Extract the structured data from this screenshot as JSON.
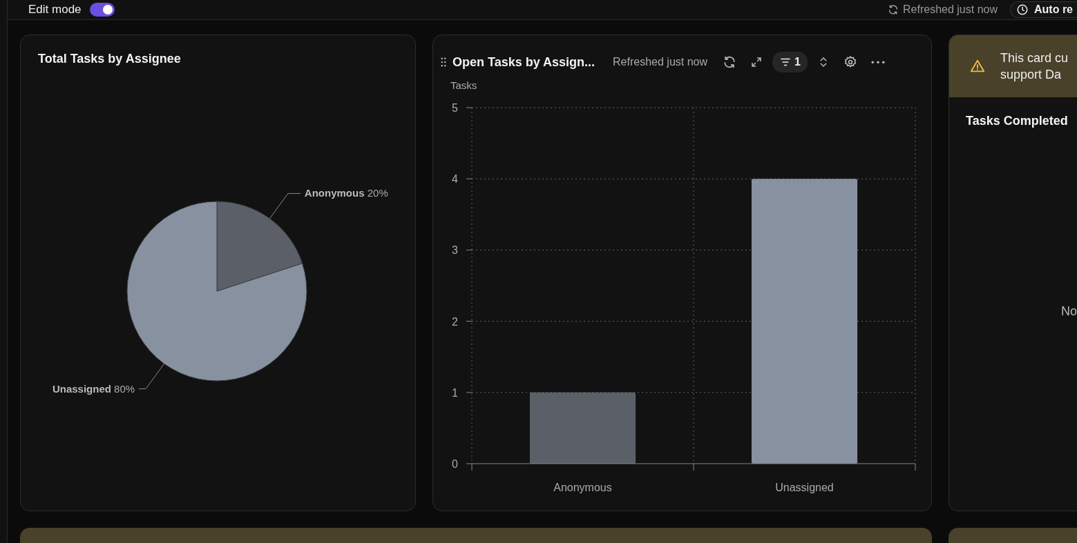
{
  "toolbar": {
    "edit_mode_label": "Edit mode",
    "edit_mode": {
      "on": true
    },
    "refresh_status": "Refreshed just now",
    "auto_refresh_label": "Auto re"
  },
  "cards": [
    {
      "kind": "pie",
      "title": "Total Tasks by Assignee",
      "chart_data": {
        "type": "pie",
        "categories": [
          "Anonymous",
          "Unassigned"
        ],
        "values": [
          20,
          80
        ],
        "colors": [
          "#5b6068",
          "#8891a0"
        ],
        "value_labels": [
          "20%",
          "80%"
        ]
      }
    },
    {
      "kind": "bar",
      "title": "Open Tasks by Assign...",
      "refresh_status": "Refreshed just now",
      "filter_count": "1",
      "chart_data": {
        "type": "bar",
        "ylabel": "Tasks",
        "categories": [
          "Anonymous",
          "Unassigned"
        ],
        "values": [
          1,
          4
        ],
        "grid": true,
        "colors": [
          "#5b6068",
          "#8891a0"
        ],
        "ylim": [
          0,
          5
        ],
        "yticks": [
          0,
          1,
          2,
          3,
          4,
          5
        ]
      }
    },
    {
      "kind": "notice",
      "warning_lines": [
        "This card cu",
        "support Da"
      ],
      "title": "Tasks Completed",
      "message": "No"
    }
  ]
}
